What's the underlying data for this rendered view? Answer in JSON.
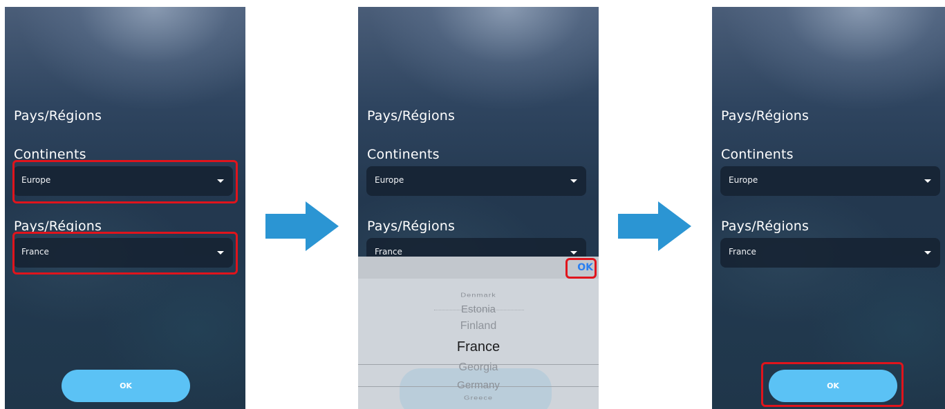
{
  "labels": {
    "title": "Pays/Régions",
    "continents": "Continents",
    "pays": "Pays/Régions"
  },
  "values": {
    "continent": "Europe",
    "pays": "France"
  },
  "buttons": {
    "ok": "OK"
  },
  "picker": {
    "done_label": "OK",
    "items": [
      "Denmark",
      "Estonia",
      "Finland",
      "France",
      "Georgia",
      "Germany",
      "Greece"
    ],
    "selected": "France"
  },
  "colors": {
    "highlight": "#e0141c",
    "arrow": "#2b95d3",
    "ok_button": "#5bc2f5",
    "picker_ok": "#2a7ff0"
  },
  "icons": {
    "arrow": "arrow-right-icon",
    "caret": "chevron-down-icon"
  }
}
